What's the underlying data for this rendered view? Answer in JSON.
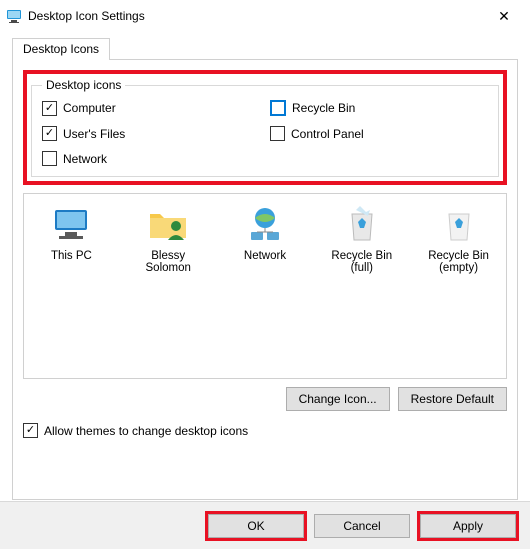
{
  "titlebar": {
    "title": "Desktop Icon Settings"
  },
  "tab": {
    "label": "Desktop Icons"
  },
  "fieldset": {
    "legend": "Desktop icons",
    "items": {
      "computer": {
        "label": "Computer",
        "checked": true
      },
      "users_files": {
        "label": "User's Files",
        "checked": true
      },
      "network": {
        "label": "Network",
        "checked": false
      },
      "recycle_bin": {
        "label": "Recycle Bin",
        "checked": false
      },
      "control_panel": {
        "label": "Control Panel",
        "checked": false
      }
    }
  },
  "preview": {
    "this_pc": {
      "label": "This PC"
    },
    "user": {
      "label1": "Blessy",
      "label2": "Solomon"
    },
    "network": {
      "label": "Network"
    },
    "recycle_full": {
      "label1": "Recycle Bin",
      "label2": "(full)"
    },
    "recycle_empty": {
      "label1": "Recycle Bin",
      "label2": "(empty)"
    }
  },
  "buttons": {
    "change_icon": "Change Icon...",
    "restore_default": "Restore Default",
    "ok": "OK",
    "cancel": "Cancel",
    "apply": "Apply"
  },
  "allow_themes": {
    "label": "Allow themes to change desktop icons",
    "checked": true
  }
}
